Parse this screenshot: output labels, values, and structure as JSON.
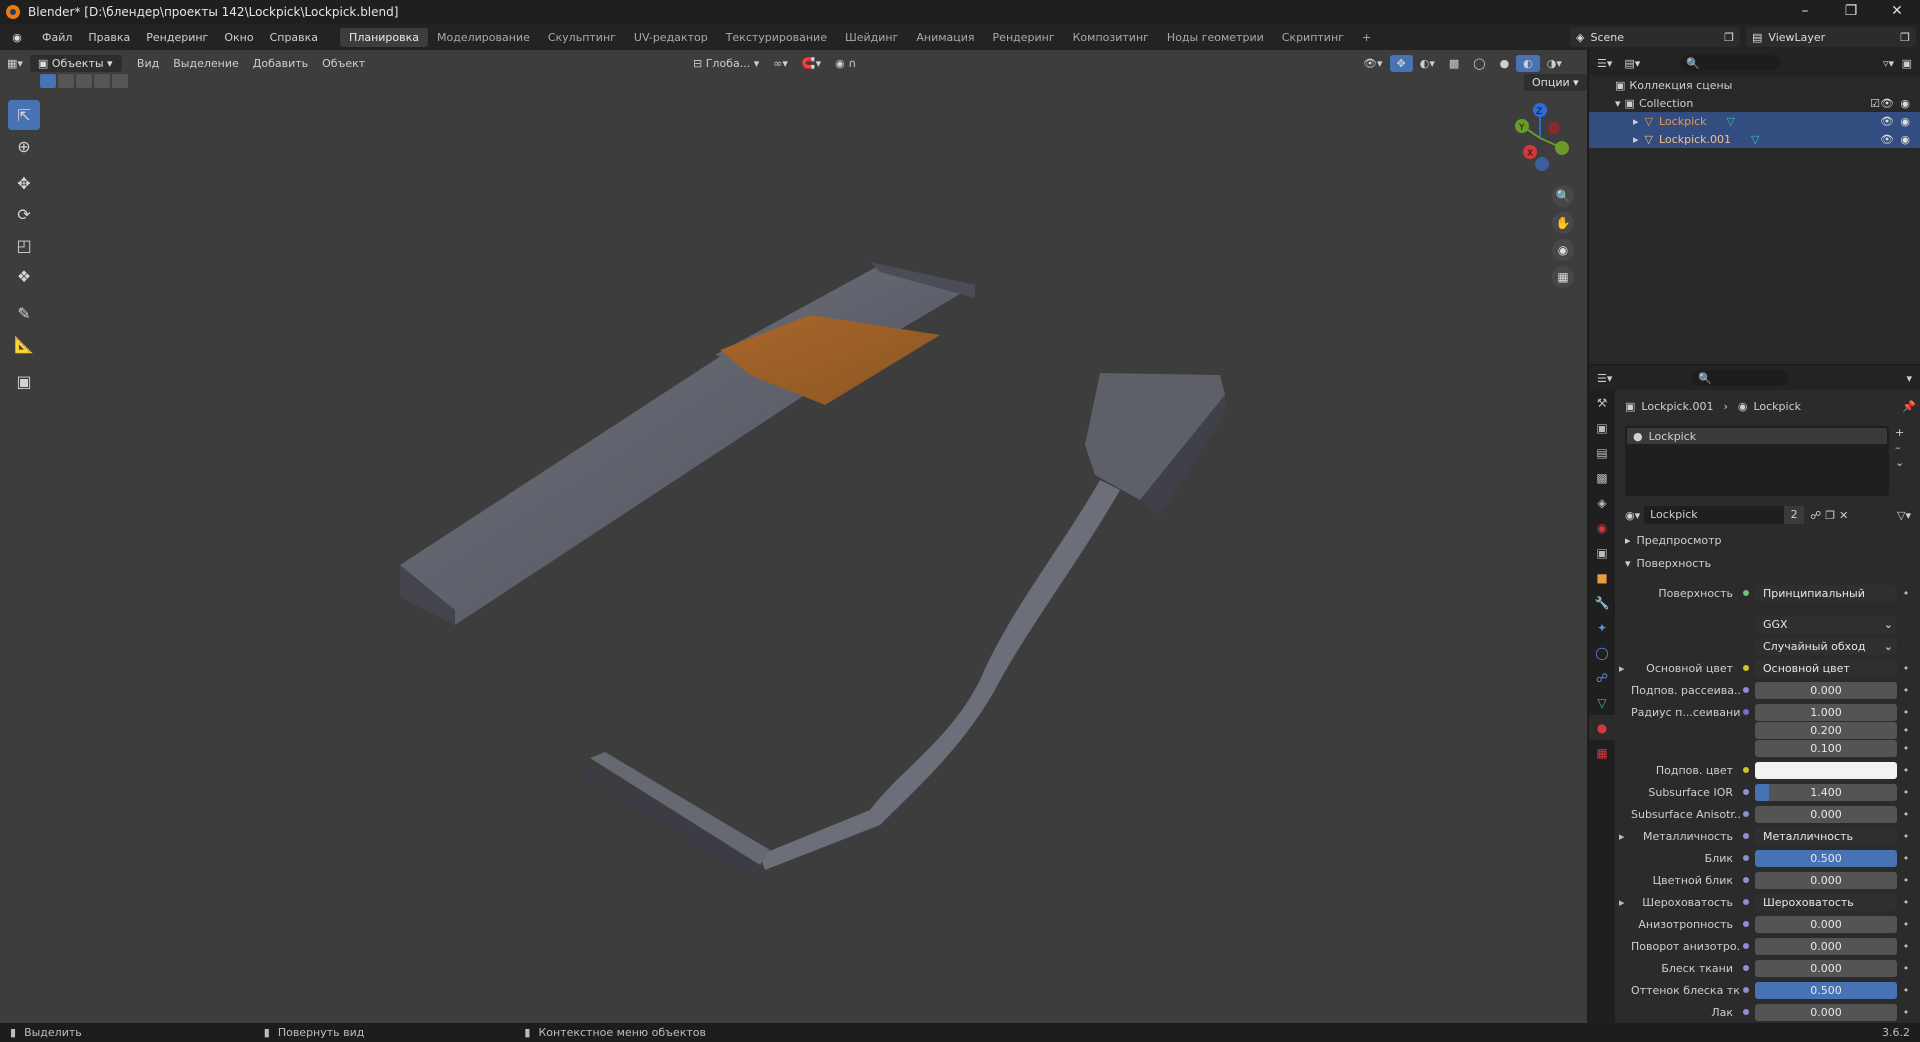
{
  "window": {
    "title": "Blender* [D:\\блендер\\проекты 142\\Lockpick\\Lockpick.blend]"
  },
  "menu": {
    "items": [
      "Файл",
      "Правка",
      "Рендеринг",
      "Окно",
      "Справка"
    ]
  },
  "workspaces": [
    "Планировка",
    "Моделирование",
    "Скульптинг",
    "UV-редактор",
    "Текстурирование",
    "Шейдинг",
    "Анимация",
    "Рендеринг",
    "Композитинг",
    "Ноды геометрии",
    "Скриптинг"
  ],
  "active_workspace": "Планировка",
  "scene_name": "Scene",
  "view_layer": "ViewLayer",
  "viewport": {
    "mode": "Объекты",
    "menus": [
      "Вид",
      "Выделение",
      "Добавить",
      "Объект"
    ],
    "transform_orientation": "Глоба...",
    "options": "Опции"
  },
  "outliner": {
    "root": "Коллекция сцены",
    "collection": "Collection",
    "objects": [
      {
        "name": "Lockpick",
        "color": "#e89b3c",
        "selected": true
      },
      {
        "name": "Lockpick.001",
        "color": "#f2c08a",
        "selected": true
      }
    ]
  },
  "properties": {
    "breadcrumb": [
      "Lockpick.001",
      "Lockpick"
    ],
    "slot": "Lockpick",
    "material_name": "Lockpick",
    "material_users": "2",
    "panels": {
      "preview": "Предпросмотр",
      "surface": "Поверхность"
    },
    "rows": [
      {
        "label": "Поверхность",
        "value": "Принципиальный BSDF",
        "kind": "link",
        "dot": "#6fc26f"
      },
      {
        "label": "",
        "value": "GGX",
        "kind": "dropdown"
      },
      {
        "label": "",
        "value": "Случайный обход",
        "kind": "dropdown"
      },
      {
        "label": "Основной цвет",
        "value": "Основной цвет",
        "kind": "link",
        "dot": "#c7c729",
        "arrow": true
      },
      {
        "label": "Подпов. рассеива...",
        "value": "0.000",
        "kind": "num",
        "dot": "#8f8fd4"
      },
      {
        "label": "Радиус п...сеивания",
        "value": "1.000",
        "kind": "num",
        "dot": "#6f6fd4"
      },
      {
        "label": "",
        "value": "0.200",
        "kind": "num"
      },
      {
        "label": "",
        "value": "0.100",
        "kind": "num"
      },
      {
        "label": "Подпов. цвет",
        "value": "",
        "kind": "color",
        "dot": "#c7c729"
      },
      {
        "label": "Subsurface IOR",
        "value": "1.400",
        "kind": "num",
        "dot": "#8f8fd4",
        "fill": 0.1
      },
      {
        "label": "Subsurface Anisotr...",
        "value": "0.000",
        "kind": "num",
        "dot": "#8f8fd4"
      },
      {
        "label": "Металличность",
        "value": "Металличность",
        "kind": "link",
        "dot": "#8f8fd4",
        "arrow": true
      },
      {
        "label": "Блик",
        "value": "0.500",
        "kind": "num",
        "dot": "#8f8fd4",
        "fill": 0.5
      },
      {
        "label": "Цветной блик",
        "value": "0.000",
        "kind": "num",
        "dot": "#8f8fd4"
      },
      {
        "label": "Шероховатость",
        "value": "Шероховатость",
        "kind": "link",
        "dot": "#8f8fd4",
        "arrow": true
      },
      {
        "label": "Анизотропность",
        "value": "0.000",
        "kind": "num",
        "dot": "#8f8fd4"
      },
      {
        "label": "Поворот анизотро...",
        "value": "0.000",
        "kind": "num",
        "dot": "#8f8fd4"
      },
      {
        "label": "Блеск ткани",
        "value": "0.000",
        "kind": "num",
        "dot": "#8f8fd4"
      },
      {
        "label": "Оттенок блеска тк...",
        "value": "0.500",
        "kind": "num",
        "dot": "#8f8fd4",
        "fill": 0.5
      },
      {
        "label": "Лак",
        "value": "0.000",
        "kind": "num",
        "dot": "#8f8fd4"
      }
    ]
  },
  "statusbar": {
    "select": "Выделить",
    "rotate": "Повернуть вид",
    "context": "Контекстное меню объектов",
    "version": "3.6.2"
  },
  "gizmo": {
    "x": "X",
    "y": "Y",
    "z": "Z"
  }
}
